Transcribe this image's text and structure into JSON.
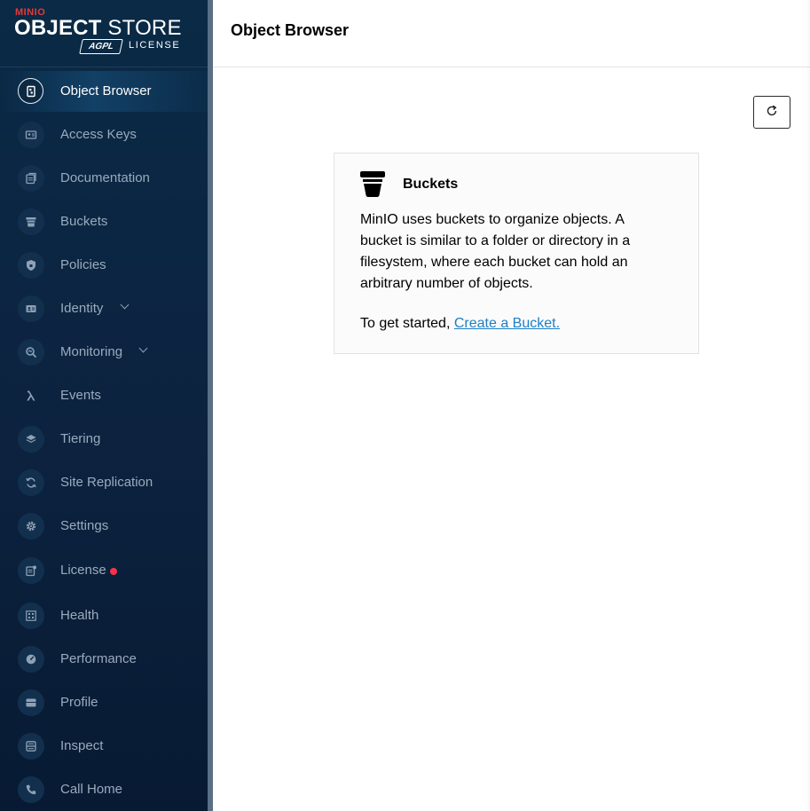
{
  "brand": {
    "minio": "MINIO",
    "title_bold": "OBJECT",
    "title_rest": " STORE",
    "badge": "AGPL",
    "license": "LICENSE"
  },
  "sidebar": {
    "items": [
      {
        "label": "Object Browser",
        "icon": "object-browser-icon",
        "active": true
      },
      {
        "label": "Access Keys",
        "icon": "access-keys-icon"
      },
      {
        "label": "Documentation",
        "icon": "documentation-icon"
      },
      {
        "label": "Buckets",
        "icon": "bucket-icon"
      },
      {
        "label": "Policies",
        "icon": "policy-shield-icon"
      },
      {
        "label": "Identity",
        "icon": "identity-icon",
        "expandable": true
      },
      {
        "label": "Monitoring",
        "icon": "monitoring-icon",
        "expandable": true
      },
      {
        "label": "Events",
        "icon": "lambda-icon"
      },
      {
        "label": "Tiering",
        "icon": "tiering-layers-icon"
      },
      {
        "label": "Site Replication",
        "icon": "site-replication-icon"
      },
      {
        "label": "Settings",
        "icon": "gear-icon"
      },
      {
        "label": "License",
        "icon": "license-icon",
        "alert_dot": true
      },
      {
        "label": "Health",
        "icon": "health-icon"
      },
      {
        "label": "Performance",
        "icon": "performance-icon"
      },
      {
        "label": "Profile",
        "icon": "profile-icon"
      },
      {
        "label": "Inspect",
        "icon": "inspect-icon"
      },
      {
        "label": "Call Home",
        "icon": "phone-icon"
      }
    ],
    "alert_color": "#f3344b"
  },
  "header": {
    "title": "Object Browser"
  },
  "toolbar": {
    "refresh_icon": "refresh-icon"
  },
  "empty_state": {
    "title": "Buckets",
    "icon": "bucket-icon",
    "description": "MinIO uses buckets to organize objects. A bucket is similar to a folder or directory in a filesystem, where each bucket can hold an arbitrary number of objects.",
    "start_prefix": "To get started, ",
    "link_text": "Create a Bucket."
  },
  "colors": {
    "sidebar_bg": "#0c2340",
    "link": "#1c7fc6",
    "brand_red": "#e53a3a"
  }
}
